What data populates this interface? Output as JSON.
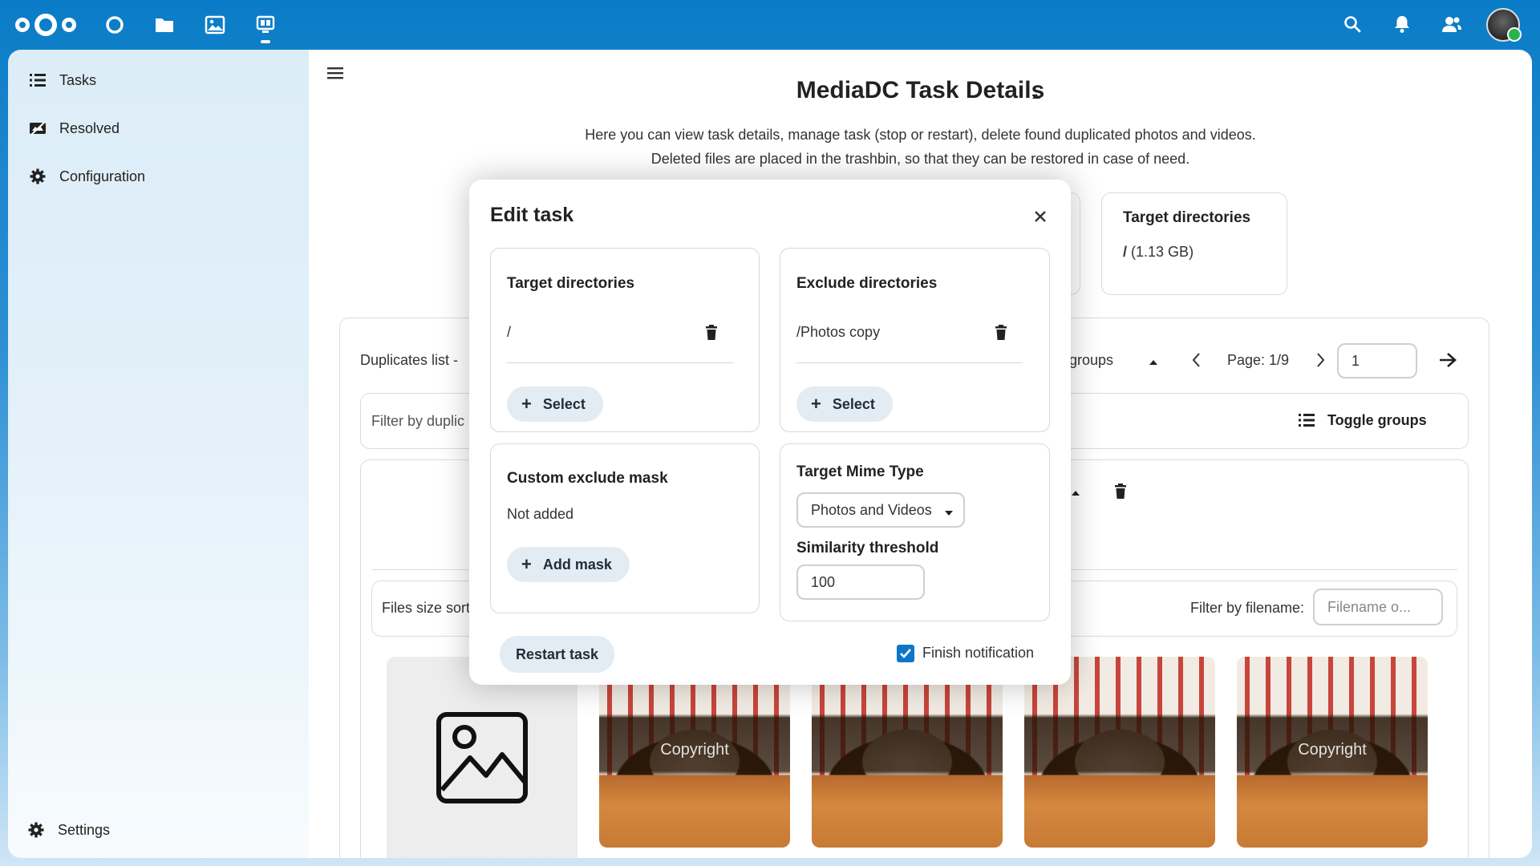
{
  "header": {
    "apps": [
      "dashboard-icon",
      "files-icon",
      "photos-icon",
      "mediadc-icon"
    ],
    "right_icons": [
      "search-icon",
      "notifications-icon",
      "contacts-icon",
      "avatar"
    ]
  },
  "sidebar": {
    "items": [
      {
        "label": "Tasks",
        "icon": "list-icon"
      },
      {
        "label": "Resolved",
        "icon": "resolved-icon"
      },
      {
        "label": "Configuration",
        "icon": "gear-icon"
      }
    ],
    "settings_label": "Settings"
  },
  "main": {
    "title": "MediaDC Task Details",
    "description_line1": "Here you can view task details, manage task (stop or restart), delete found duplicated photos and videos.",
    "description_line2": "Deleted files are placed in the trashbin, so that they can be restored in case of need.",
    "target_card": {
      "title": "Target directories",
      "value_slash": "/",
      "value_size": "(1.13 GB)"
    },
    "duplicates_label": "Duplicates list -",
    "groups_label": "groups",
    "page_label": "Page: 1/9",
    "page_input_value": "1",
    "filter_dup_placeholder": "Filter by duplic",
    "toggle_groups_label": "Toggle groups",
    "files_size_sort": "Files size sort",
    "filter_filename_label": "Filter by filename:",
    "filename_placeholder": "Filename o...",
    "watermark": "Copyright"
  },
  "modal": {
    "title": "Edit task",
    "target_dirs": {
      "title": "Target directories",
      "item": "/",
      "button": "Select"
    },
    "exclude_dirs": {
      "title": "Exclude directories",
      "item": "/Photos copy",
      "button": "Select"
    },
    "exclude_mask": {
      "title": "Custom exclude mask",
      "value": "Not added",
      "button": "Add mask"
    },
    "mime": {
      "title": "Target Mime Type",
      "value": "Photos and Videos"
    },
    "similarity": {
      "title": "Similarity threshold",
      "value": "100"
    },
    "restart_label": "Restart task",
    "finish_notification_label": "Finish notification",
    "finish_notification_checked": true
  },
  "colors": {
    "brand": "#0082c9",
    "accent": "#0e76c7"
  }
}
